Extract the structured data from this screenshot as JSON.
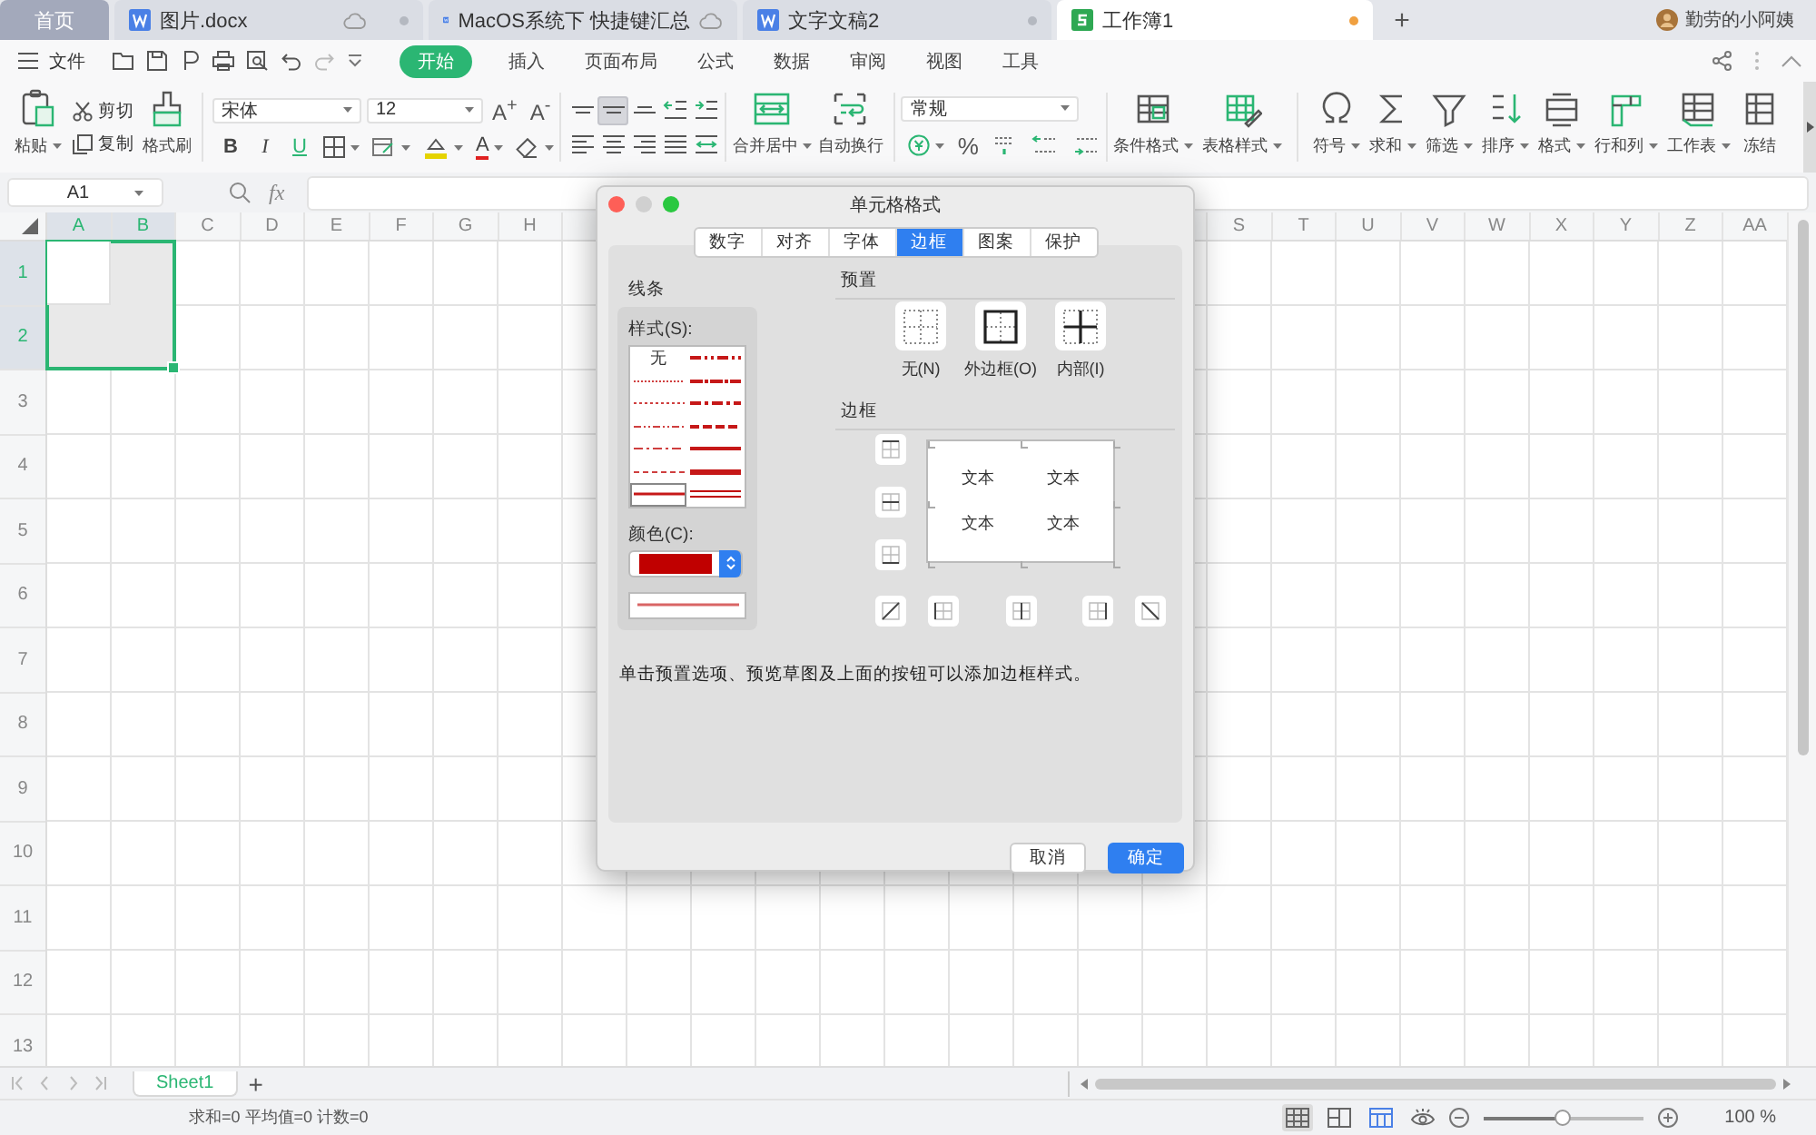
{
  "doc_tabs": [
    {
      "label": "首页",
      "kind": "home",
      "selected": false
    },
    {
      "label": "图片.docx",
      "kind": "writer",
      "selected": false,
      "cloud": true,
      "color": "#b4b8c0"
    },
    {
      "label": "MacOS系统下 快捷键汇总",
      "kind": "writer",
      "selected": false,
      "cloud": true
    },
    {
      "label": "文字文稿2",
      "kind": "writer",
      "selected": false,
      "cloud": false,
      "color": "#b4b8c0"
    },
    {
      "label": "工作簿1",
      "kind": "sheet",
      "selected": true,
      "cloud": false,
      "color": "#f0a040"
    }
  ],
  "new_tab_label": "+",
  "user": {
    "name": "勤劳的小阿姨"
  },
  "menu": {
    "file_label": "文件",
    "items": [
      {
        "label": "开始",
        "selected": true
      },
      {
        "label": "插入",
        "selected": false
      },
      {
        "label": "页面布局",
        "selected": false
      },
      {
        "label": "公式",
        "selected": false
      },
      {
        "label": "数据",
        "selected": false
      },
      {
        "label": "审阅",
        "selected": false
      },
      {
        "label": "视图",
        "selected": false
      },
      {
        "label": "工具",
        "selected": false
      }
    ]
  },
  "ribbon": {
    "paste": "粘贴",
    "cut": "剪切",
    "copy": "复制",
    "format_painter": "格式刷",
    "font": "宋体",
    "font_size": "12",
    "grow_label": "A$^{+}$",
    "shrink_label": "A$^{-}$",
    "font_color_label": "A",
    "text_buttons": [
      {
        "label": "B",
        "kind": "bold"
      },
      {
        "label": "I",
        "kind": "italic"
      },
      {
        "label": "U",
        "kind": "underline"
      }
    ],
    "align_buttons": [
      {
        "kind": "top",
        "selected": false
      },
      {
        "kind": "middle",
        "selected": true
      },
      {
        "kind": "bottom",
        "selected": false
      },
      {
        "kind": "outdent",
        "selected": false
      },
      {
        "kind": "indent",
        "selected": false
      },
      {
        "kind": "left",
        "selected": false
      },
      {
        "kind": "center",
        "selected": false
      },
      {
        "kind": "right",
        "selected": false
      },
      {
        "kind": "justify",
        "selected": false
      },
      {
        "kind": "distributed",
        "selected": false
      }
    ],
    "merge": "合并居中",
    "wrap": "自动换行",
    "number_format": "常规",
    "percent": "%",
    "tools": [
      {
        "label": "条件格式",
        "kind": "conditional"
      },
      {
        "label": "表格样式",
        "kind": "table_style"
      },
      {
        "label": "符号",
        "kind": "symbol"
      },
      {
        "label": "求和",
        "kind": "sum"
      },
      {
        "label": "筛选",
        "kind": "filter"
      },
      {
        "label": "排序",
        "kind": "sort"
      },
      {
        "label": "格式",
        "kind": "format"
      },
      {
        "label": "行和列",
        "kind": "rows_cols"
      },
      {
        "label": "工作表",
        "kind": "worksheet"
      },
      {
        "label": "冻结",
        "kind": "freeze"
      }
    ]
  },
  "formula_bar": {
    "cell": "A1",
    "fx": "fx"
  },
  "sheet": {
    "columns_left": [
      {
        "label": "A",
        "selected": true
      },
      {
        "label": "B",
        "selected": true
      },
      {
        "label": "C",
        "selected": false
      },
      {
        "label": "D",
        "selected": false
      },
      {
        "label": "E",
        "selected": false
      },
      {
        "label": "F",
        "selected": false
      },
      {
        "label": "G",
        "selected": false
      },
      {
        "label": "H",
        "selected": false
      }
    ],
    "columns_right": [
      {
        "label": "S",
        "selected": false
      },
      {
        "label": "T",
        "selected": false
      },
      {
        "label": "U",
        "selected": false
      },
      {
        "label": "V",
        "selected": false
      },
      {
        "label": "W",
        "selected": false
      },
      {
        "label": "X",
        "selected": false
      },
      {
        "label": "Y",
        "selected": false
      },
      {
        "label": "Z",
        "selected": false
      },
      {
        "label": "AA",
        "selected": false
      }
    ],
    "rows": [
      {
        "label": "1",
        "selected": true
      },
      {
        "label": "2",
        "selected": true
      },
      {
        "label": "3",
        "selected": false
      },
      {
        "label": "4",
        "selected": false
      },
      {
        "label": "5",
        "selected": false
      },
      {
        "label": "6",
        "selected": false
      },
      {
        "label": "7",
        "selected": false
      },
      {
        "label": "8",
        "selected": false
      },
      {
        "label": "9",
        "selected": false
      },
      {
        "label": "10",
        "selected": false
      },
      {
        "label": "11",
        "selected": false
      },
      {
        "label": "12",
        "selected": false
      },
      {
        "label": "13",
        "selected": false
      }
    ]
  },
  "sheet_tabs": [
    {
      "label": "Sheet1",
      "selected": true
    }
  ],
  "add_sheet_label": "+",
  "status": {
    "summary": "求和=0 平均值=0 计数=0",
    "zoom": "100 %",
    "views": [
      {
        "kind": "normal",
        "selected": true
      },
      {
        "kind": "page_break",
        "selected": false
      },
      {
        "kind": "page_layout",
        "selected": false
      },
      {
        "kind": "reading",
        "selected": false
      }
    ],
    "zoom_slider": {
      "level": 0.5
    }
  },
  "dialog": {
    "title": "单元格格式",
    "tabs": [
      {
        "label": "数字",
        "selected": false
      },
      {
        "label": "对齐",
        "selected": false
      },
      {
        "label": "字体",
        "selected": false
      },
      {
        "label": "边框",
        "selected": true
      },
      {
        "label": "图案",
        "selected": false
      },
      {
        "label": "保护",
        "selected": false
      }
    ],
    "line_group": "线条",
    "style_label": "样式(S):",
    "styles": [
      {
        "kind": "none",
        "label": "无",
        "selected": false
      },
      {
        "kind": "hair",
        "selected": false
      },
      {
        "kind": "dotted",
        "selected": false
      },
      {
        "kind": "dash_dot_dot",
        "selected": false
      },
      {
        "kind": "dash_dot",
        "selected": false
      },
      {
        "kind": "dashed",
        "selected": false
      },
      {
        "kind": "thin",
        "selected": true
      },
      {
        "kind": "medium_dash_dot_dot",
        "selected": false
      },
      {
        "kind": "slanted_dash_dot",
        "selected": false
      },
      {
        "kind": "medium_dash_dot",
        "selected": false
      },
      {
        "kind": "medium_dashed",
        "selected": false
      },
      {
        "kind": "medium",
        "selected": false
      },
      {
        "kind": "thick",
        "selected": false
      },
      {
        "kind": "double",
        "selected": false
      }
    ],
    "color_label": "颜色(C):",
    "color": "#c00000",
    "preset_label": "预置",
    "presets": [
      {
        "label": "无(N)",
        "kind": "none"
      },
      {
        "label": "外边框(O)",
        "kind": "outline"
      },
      {
        "label": "内部(I)",
        "kind": "inside"
      }
    ],
    "border_label": "边框",
    "side_buttons": [
      {
        "kind": "top"
      },
      {
        "kind": "inner_h"
      },
      {
        "kind": "bottom"
      }
    ],
    "bottom_buttons": [
      {
        "kind": "diag_up"
      },
      {
        "kind": "left"
      },
      {
        "kind": "inner_v"
      },
      {
        "kind": "right"
      },
      {
        "kind": "diag_down"
      }
    ],
    "preview_texts": [
      "文本",
      "文本",
      "文本",
      "文本"
    ],
    "hint": "单击预置选项、预览草图及上面的按钮可以添加边框样式。",
    "buttons": [
      {
        "label": "取消",
        "kind": "cancel"
      },
      {
        "label": "确定",
        "kind": "default"
      }
    ]
  }
}
